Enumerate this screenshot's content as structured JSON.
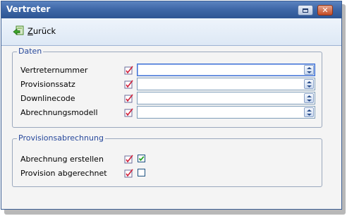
{
  "window": {
    "title": "Vertreter"
  },
  "toolbar": {
    "back_label_first": "Z",
    "back_label_rest": "urück"
  },
  "daten": {
    "legend": "Daten",
    "fields": [
      {
        "label": "Vertreternummer",
        "value": ""
      },
      {
        "label": "Provisionssatz",
        "value": ""
      },
      {
        "label": "Downlinecode",
        "value": ""
      },
      {
        "label": "Abrechnungsmodell",
        "value": ""
      }
    ]
  },
  "provision": {
    "legend": "Provisionsabrechnung",
    "checks": [
      {
        "label": "Abrechnung erstellen",
        "checked": true
      },
      {
        "label": "Provision abgerechnet",
        "checked": false
      }
    ]
  }
}
